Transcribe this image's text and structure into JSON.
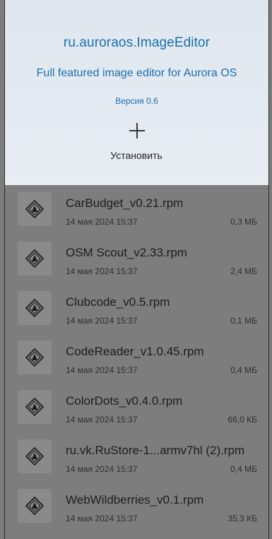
{
  "header": {
    "app_id": "ru.auroraos.ImageEditor",
    "description": "Full featured image editor for Aurora OS",
    "version": "Версия 0.6",
    "install_label": "Установить",
    "install_icon": "plus-icon",
    "accent_color": "#1b6fb0"
  },
  "files": [
    {
      "name": "CarBudget_v0.21.rpm",
      "date": "14 мая 2024 15:37",
      "size": "0,3 МБ",
      "icon": "package-icon"
    },
    {
      "name": "OSM Scout_v2.33.rpm",
      "date": "14 мая 2024 15:37",
      "size": "2,4 МБ",
      "icon": "package-icon"
    },
    {
      "name": "Clubcode_v0.5.rpm",
      "date": "14 мая 2024 15:37",
      "size": "0,1 МБ",
      "icon": "package-icon"
    },
    {
      "name": "CodeReader_v1.0.45.rpm",
      "date": "14 мая 2024 15:37",
      "size": "0,4 МБ",
      "icon": "package-icon"
    },
    {
      "name": "ColorDots_v0.4.0.rpm",
      "date": "14 мая 2024 15:37",
      "size": "66,0 КБ",
      "icon": "package-icon"
    },
    {
      "name": "ru.vk.RuStore-1...armv7hl (2).rpm",
      "date": "14 мая 2024 15:37",
      "size": "0,4 МБ",
      "icon": "package-icon"
    },
    {
      "name": "WebWildberries_v0.1.rpm",
      "date": "14 мая 2024 15:37",
      "size": "35,3 КБ",
      "icon": "package-icon"
    }
  ]
}
